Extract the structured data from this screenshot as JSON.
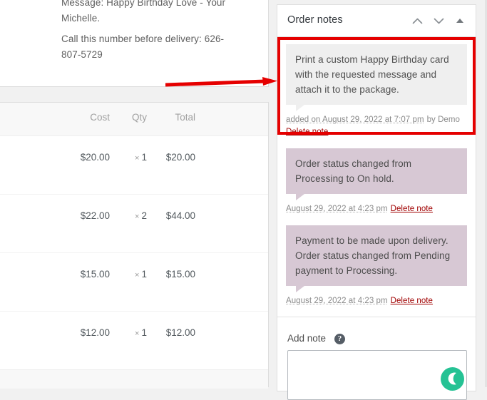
{
  "order_meta": {
    "message_line": "Message: Happy Birthday Love - Your Michelle.",
    "phone_line": "Call this number before delivery: 626-807-5729"
  },
  "items_table": {
    "columns": [
      "Cost",
      "Qty",
      "Total"
    ],
    "rows": [
      {
        "cost": "$20.00",
        "mul": "×",
        "qty": "1",
        "total": "$20.00"
      },
      {
        "cost": "$22.00",
        "mul": "×",
        "qty": "2",
        "total": "$44.00"
      },
      {
        "cost": "$15.00",
        "mul": "×",
        "qty": "1",
        "total": "$15.00"
      },
      {
        "cost": "$12.00",
        "mul": "×",
        "qty": "1",
        "total": "$12.00"
      }
    ]
  },
  "notes_panel": {
    "title": "Order notes",
    "header_icons": [
      "chevron-up",
      "chevron-down",
      "collapse-triangle"
    ],
    "notes": [
      {
        "type": "customer",
        "text": "Print a custom Happy Birthday card with the requested message and attach it to the package.",
        "date": "added on August 29, 2022 at 7:07 pm",
        "by": "by Demo",
        "delete_label": "Delete note"
      },
      {
        "type": "system",
        "text": "Order status changed from Processing to On hold.",
        "date": "August 29, 2022 at 4:23 pm",
        "by": "",
        "delete_label": "Delete note"
      },
      {
        "type": "system",
        "text": "Payment to be made upon delivery. Order status changed from Pending payment to Processing.",
        "date": "August 29, 2022 at 4:23 pm",
        "by": "",
        "delete_label": "Delete note"
      }
    ],
    "add_note": {
      "label": "Add note",
      "help_glyph": "?",
      "textarea_value": "",
      "textarea_placeholder": ""
    }
  },
  "annotation": {
    "highlight_color": "#e50000",
    "arrow_color": "#e50000",
    "arrow_direction": "right"
  },
  "chat_widget": {
    "color": "#25c294",
    "icon": "chat-moon-icon"
  }
}
